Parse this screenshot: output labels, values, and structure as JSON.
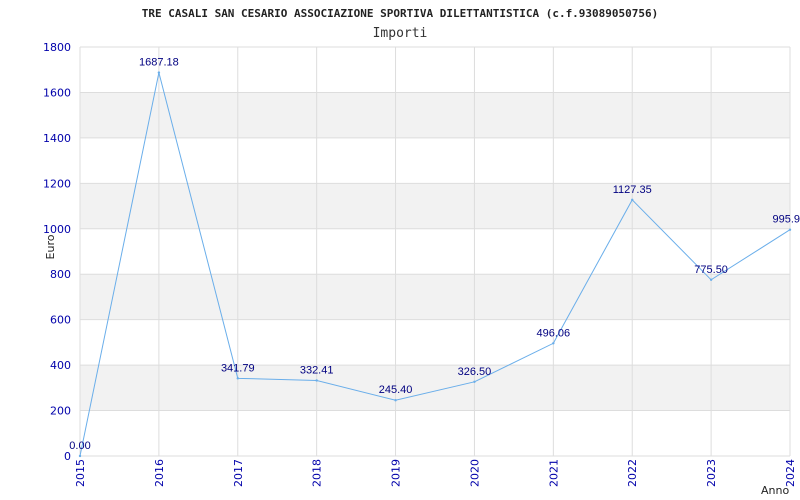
{
  "chart_data": {
    "type": "line",
    "title": "TRE CASALI SAN CESARIO ASSOCIAZIONE SPORTIVA DILETTANTISTICA (c.f.93089050756)",
    "subtitle": "Importi",
    "xlabel": "Anno",
    "ylabel": "Euro",
    "categories": [
      "2015",
      "2016",
      "2017",
      "2018",
      "2019",
      "2020",
      "2021",
      "2022",
      "2023",
      "2024"
    ],
    "values": [
      0.0,
      1687.18,
      341.79,
      332.41,
      245.4,
      326.5,
      496.06,
      1127.35,
      775.5,
      995.9
    ],
    "data_labels": [
      "0.00",
      "1687.18",
      "341.79",
      "332.41",
      "245.40",
      "326.50",
      "496.06",
      "1127.35",
      "775.50",
      "995.9"
    ],
    "yticks": [
      "0",
      "200",
      "400",
      "600",
      "800",
      "1000",
      "1200",
      "1400",
      "1600",
      "1800"
    ],
    "ylim": [
      0,
      1800
    ],
    "grid": true,
    "legend": "none",
    "colors": {
      "line": "#6aaeea",
      "band": "#f2f2f2",
      "gridline": "#dddddd",
      "tick_text": "#0000aa",
      "label_text": "#000080"
    }
  }
}
